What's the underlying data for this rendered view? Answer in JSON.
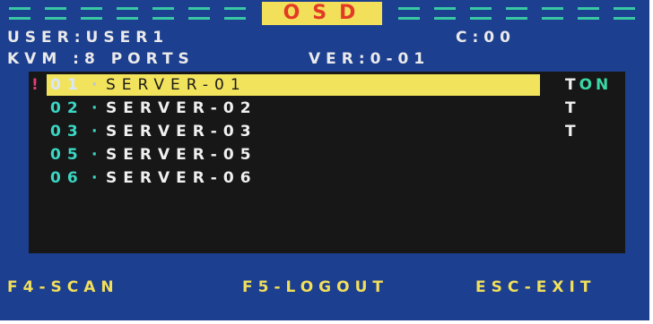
{
  "title": "OSD",
  "header": {
    "user_line": "USER:USER1",
    "channel": "C:00",
    "kvm_line": "KVM :8 PORTS",
    "version": "VER:0-01"
  },
  "servers": [
    {
      "num": "01",
      "name": "SERVER-01",
      "selected": true,
      "flag_t": "T",
      "flag_on": "ON"
    },
    {
      "num": "02",
      "name": "SERVER-02",
      "selected": false,
      "flag_t": "T",
      "flag_on": ""
    },
    {
      "num": "03",
      "name": "SERVER-03",
      "selected": false,
      "flag_t": "T",
      "flag_on": ""
    },
    {
      "num": "05",
      "name": "SERVER-05",
      "selected": false,
      "flag_t": "",
      "flag_on": ""
    },
    {
      "num": "06",
      "name": "SERVER-06",
      "selected": false,
      "flag_t": "",
      "flag_on": ""
    }
  ],
  "selection_marker": "!",
  "footer": {
    "scan": "F4-SCAN",
    "logout": "F5-LOGOUT",
    "exit": "ESC-EXIT"
  },
  "colors": {
    "background": "#1d3f8f",
    "panel": "#171717",
    "highlight": "#f2e35c",
    "port_number": "#3bd7c4",
    "title_text": "#e23a26",
    "footer_text": "#f2df5a"
  }
}
